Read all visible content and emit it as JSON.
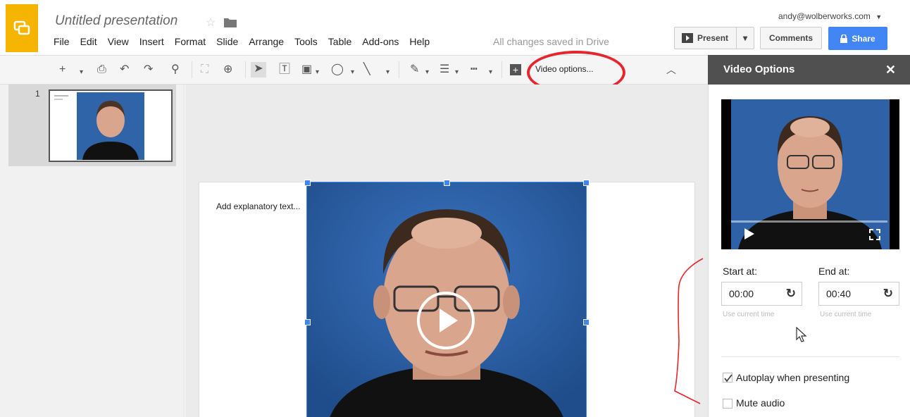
{
  "header": {
    "title": "Untitled presentation",
    "menu": [
      "File",
      "Edit",
      "View",
      "Insert",
      "Format",
      "Slide",
      "Arrange",
      "Tools",
      "Table",
      "Add-ons",
      "Help"
    ],
    "save_status": "All changes saved in Drive",
    "account": "andy@wolberworks.com",
    "present_label": "Present",
    "comments_label": "Comments",
    "share_label": "Share"
  },
  "toolbar": {
    "video_options_label": "Video options..."
  },
  "filmstrip": {
    "slides": [
      {
        "number": "1"
      }
    ]
  },
  "slide": {
    "placeholder_text": "Add explanatory text..."
  },
  "panel": {
    "title": "Video Options",
    "start_label": "Start at:",
    "start_value": "00:00",
    "end_label": "End at:",
    "end_value": "00:40",
    "use_current_time": "Use current time",
    "autoplay_label": "Autoplay when presenting",
    "autoplay_checked": true,
    "mute_label": "Mute audio",
    "mute_checked": false
  },
  "colors": {
    "accent_blue": "#4285f4",
    "logo_yellow": "#f4b400",
    "annotation_red": "#e5262d",
    "panel_header": "#505050"
  }
}
